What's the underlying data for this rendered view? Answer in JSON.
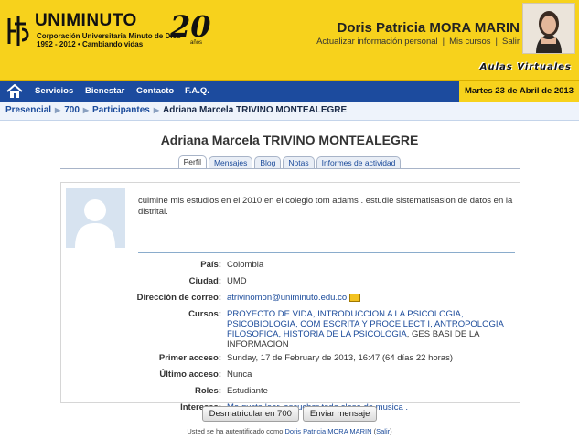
{
  "header": {
    "logo_name": "UNIMINUTO",
    "logo_sub_1": "Corporación Universitaria Minuto de Dios",
    "logo_sub_2": "1992 - 2012  •  Cambiando vidas",
    "anniv_number": "20",
    "anniv_word": "años",
    "user_name": "Doris Patricia MORA MARIN",
    "links": [
      "Actualizar información personal",
      "Mis cursos",
      "Salir"
    ],
    "platform": "Aulas Virtuales"
  },
  "nav": {
    "items": [
      "Servicios",
      "Bienestar",
      "Contacto",
      "F.A.Q."
    ],
    "date": "Martes 23 de Abril de 2013"
  },
  "breadcrumb": [
    "Presencial",
    "700",
    "Participantes",
    "Adriana Marcela TRIVINO MONTEALEGRE"
  ],
  "title": "Adriana Marcela TRIVINO MONTEALEGRE",
  "tabs": [
    "Perfil",
    "Mensajes",
    "Blog",
    "Notas",
    "Informes de actividad"
  ],
  "profile": {
    "description": "culmine mis estudios en el 2010 en el colegio tom adams . estudie sistematisasion de datos en la distrital.",
    "fields": [
      {
        "label": "País:",
        "value": "Colombia"
      },
      {
        "label": "Ciudad:",
        "value": "UMD"
      },
      {
        "label": "Dirección de correo:",
        "value": "atrivinomon@uniminuto.edu.co"
      },
      {
        "label": "Cursos:",
        "value_links": "PROYECTO DE VIDA, INTRODUCCION A LA PSICOLOGIA, PSICOBIOLOGIA, COM ESCRITA Y PROCE LECT I, ANTROPOLOGIA FILOSOFICA, HISTORIA DE LA PSICOLOGIA",
        "value_plain": ", GES BASI DE LA INFORMACION"
      },
      {
        "label": "Primer acceso:",
        "value": "Sunday, 17 de February de 2013, 16:47  (64 días 22 horas)"
      },
      {
        "label": "Último acceso:",
        "value": "Nunca"
      },
      {
        "label": "Roles:",
        "value": "Estudiante"
      },
      {
        "label": "Intereses:",
        "value": "Me gusta leer, escuchar toda clase de musica ."
      }
    ]
  },
  "buttons": [
    "Desmatricular en 700",
    "Enviar mensaje"
  ],
  "footer": {
    "prefix": "Usted se ha autentificado como ",
    "user": "Doris Patricia MORA MARIN",
    "logout": "Salir"
  },
  "colors": {
    "header_bg": "#f7d21c",
    "nav_bg": "#1c4b9e",
    "link": "#1a4a9a"
  }
}
